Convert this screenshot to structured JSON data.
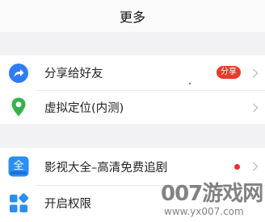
{
  "header": {
    "title": "更多"
  },
  "items": [
    {
      "label": "分享给好友",
      "badge": "分享",
      "icon": "share-icon",
      "icon_color": "#2f7df6"
    },
    {
      "label": "虚拟定位(内测)",
      "icon": "location-pin-icon",
      "icon_color": "#35b34a"
    },
    {
      "label": "影视大全–高清免费追剧",
      "icon": "app-icon",
      "icon_text": "全",
      "icon_color": "#2b8ff0"
    },
    {
      "label": "开启权限",
      "icon": "permissions-icon",
      "icon_color": "#2b8ff0"
    }
  ],
  "colors": {
    "badge": "#e83b2c",
    "dot": "#e8312a",
    "background": "#f2f2f5"
  },
  "watermark": {
    "main": "007游戏网",
    "url": "www.yx007.com"
  }
}
